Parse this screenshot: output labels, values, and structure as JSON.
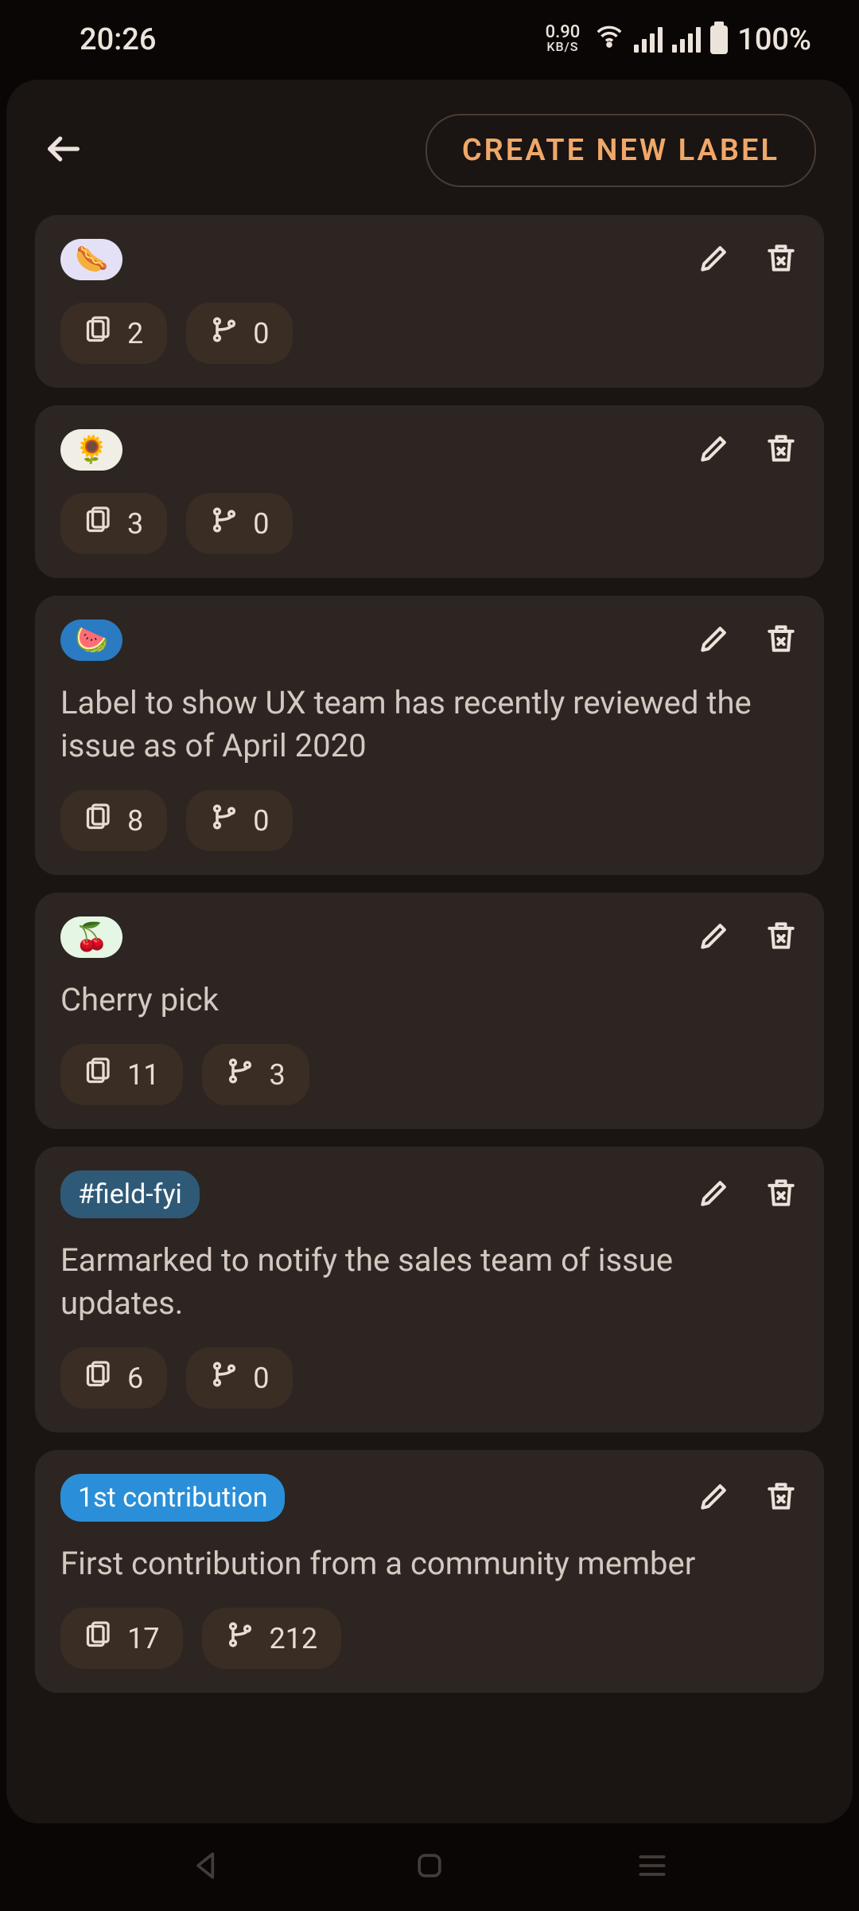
{
  "status": {
    "time": "20:26",
    "kbs_top": "0.90",
    "kbs_bot": "KB/S",
    "battery": "100%"
  },
  "header": {
    "create_label": "CREATE NEW LABEL"
  },
  "labels": [
    {
      "tag_text": "🌭",
      "tag_bg": "#e4e0f6",
      "desc": "",
      "issues": "2",
      "merges": "0"
    },
    {
      "tag_text": "🌻",
      "tag_bg": "#f1eee6",
      "desc": "",
      "issues": "3",
      "merges": "0"
    },
    {
      "tag_text": "🍉",
      "tag_bg": "#2a7bc2",
      "desc": "Label to show UX team has recently reviewed the issue as of April 2020",
      "issues": "8",
      "merges": "0"
    },
    {
      "tag_text": "🍒",
      "tag_bg": "#e5f6e5",
      "desc": "Cherry pick",
      "issues": "11",
      "merges": "3"
    },
    {
      "tag_text": "#field-fyi",
      "tag_bg": "#2f5a77",
      "desc": "Earmarked to notify the sales team of issue updates.",
      "issues": "6",
      "merges": "0"
    },
    {
      "tag_text": "1st contribution",
      "tag_bg": "#2a8fd8",
      "desc": "First contribution from a community member",
      "issues": "17",
      "merges": "212"
    }
  ]
}
